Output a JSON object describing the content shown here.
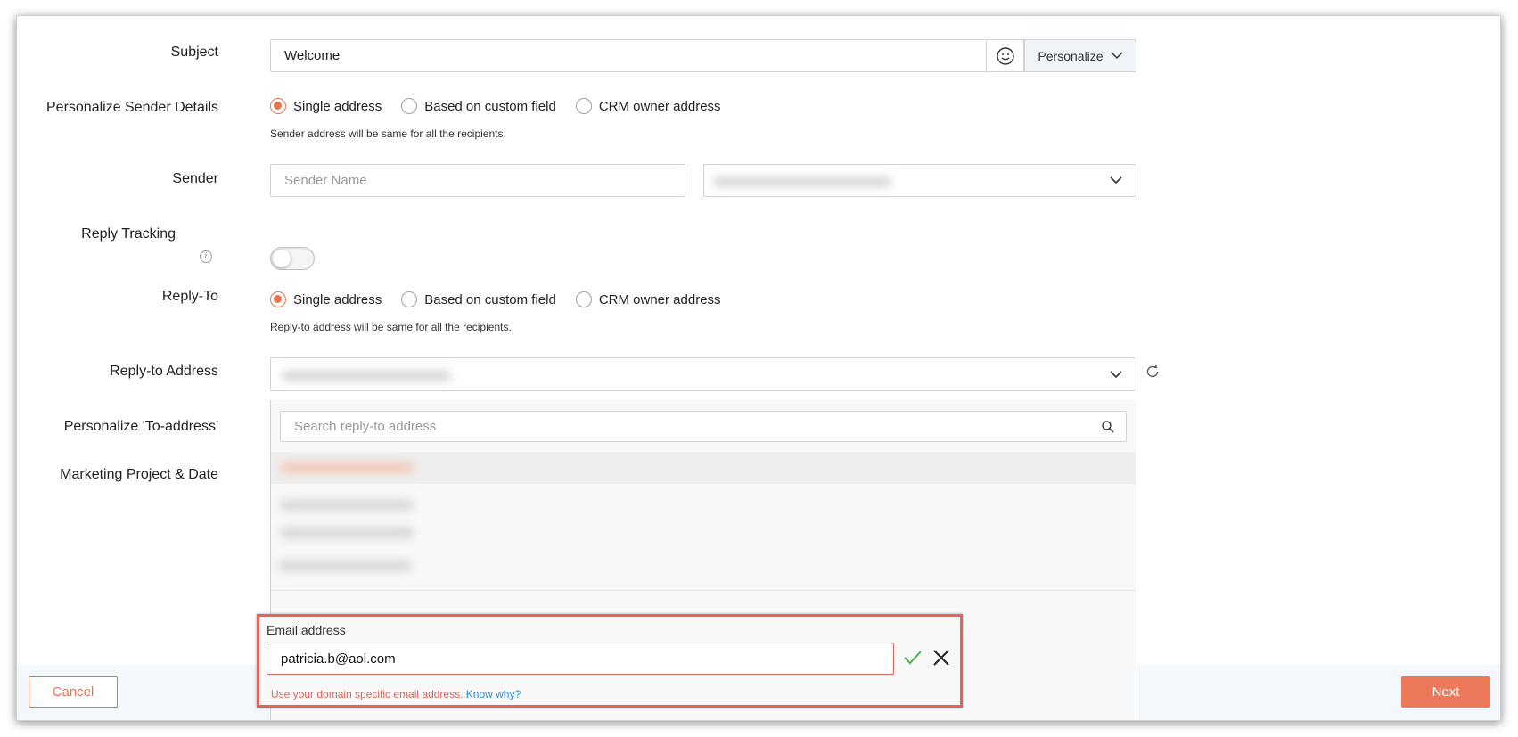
{
  "form": {
    "subject": {
      "label": "Subject",
      "value": "Welcome",
      "personalize_label": "Personalize"
    },
    "sender_details": {
      "label": "Personalize Sender Details",
      "options": [
        "Single address",
        "Based on custom field",
        "CRM owner address"
      ],
      "selected": "Single address",
      "hint": "Sender address will be same for all the recipients."
    },
    "sender": {
      "label": "Sender",
      "name_placeholder": "Sender Name"
    },
    "reply_tracking": {
      "label": "Reply Tracking",
      "enabled": false
    },
    "reply_to": {
      "label": "Reply-To",
      "options": [
        "Single address",
        "Based on custom field",
        "CRM owner address"
      ],
      "selected": "Single address",
      "hint": "Reply-to address will be same for all the recipients."
    },
    "reply_to_address": {
      "label": "Reply-to Address",
      "search_placeholder": "Search reply-to address"
    },
    "personalize_to": {
      "label": "Personalize 'To-address'"
    },
    "marketing_project": {
      "label": "Marketing Project & Date"
    }
  },
  "email_popup": {
    "label": "Email address",
    "value": "patricia.b@aol.com",
    "error": "Use your domain specific email address.",
    "link": "Know why?"
  },
  "footer": {
    "cancel_label": "Cancel",
    "next_label": "Next"
  },
  "colors": {
    "accent": "#e8734f",
    "error": "#e0645a",
    "link": "#2d8fd5",
    "confirm": "#4caf50"
  }
}
